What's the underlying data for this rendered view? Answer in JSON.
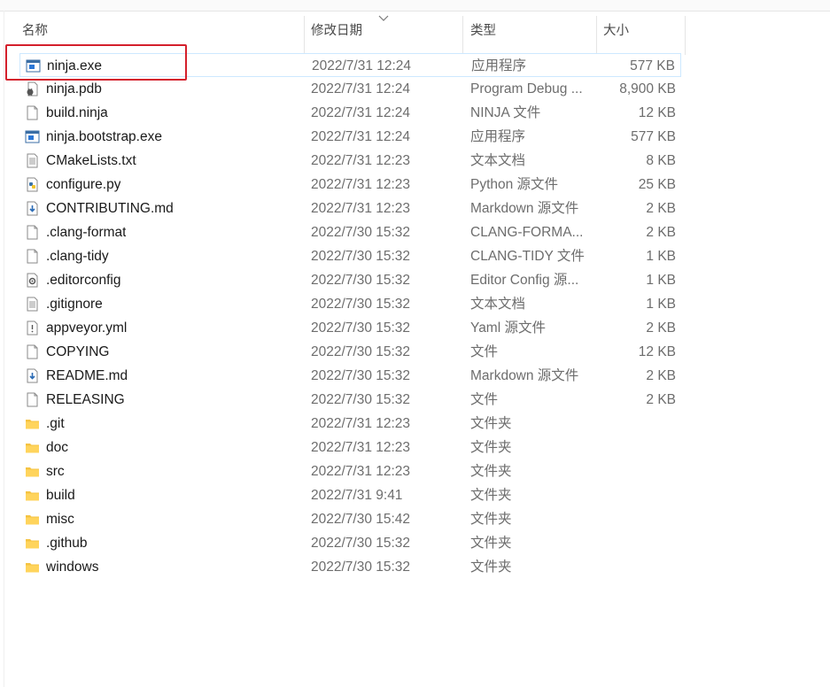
{
  "columns": {
    "name": "名称",
    "date": "修改日期",
    "type": "类型",
    "size": "大小"
  },
  "files": [
    {
      "name": "ninja.exe",
      "date": "2022/7/31 12:24",
      "type": "应用程序",
      "size": "577 KB",
      "icon": "exe-icon"
    },
    {
      "name": "ninja.pdb",
      "date": "2022/7/31 12:24",
      "type": "Program Debug ...",
      "size": "8,900 KB",
      "icon": "pdb-icon"
    },
    {
      "name": "build.ninja",
      "date": "2022/7/31 12:24",
      "type": "NINJA 文件",
      "size": "12 KB",
      "icon": "file-icon"
    },
    {
      "name": "ninja.bootstrap.exe",
      "date": "2022/7/31 12:24",
      "type": "应用程序",
      "size": "577 KB",
      "icon": "exe-icon"
    },
    {
      "name": "CMakeLists.txt",
      "date": "2022/7/31 12:23",
      "type": "文本文档",
      "size": "8 KB",
      "icon": "text-file-icon"
    },
    {
      "name": "configure.py",
      "date": "2022/7/31 12:23",
      "type": "Python 源文件",
      "size": "25 KB",
      "icon": "python-file-icon"
    },
    {
      "name": "CONTRIBUTING.md",
      "date": "2022/7/31 12:23",
      "type": "Markdown 源文件",
      "size": "2 KB",
      "icon": "markdown-file-icon"
    },
    {
      "name": ".clang-format",
      "date": "2022/7/30 15:32",
      "type": "CLANG-FORMA...",
      "size": "2 KB",
      "icon": "file-icon"
    },
    {
      "name": ".clang-tidy",
      "date": "2022/7/30 15:32",
      "type": "CLANG-TIDY 文件",
      "size": "1 KB",
      "icon": "file-icon"
    },
    {
      "name": ".editorconfig",
      "date": "2022/7/30 15:32",
      "type": "Editor Config 源...",
      "size": "1 KB",
      "icon": "config-file-icon"
    },
    {
      "name": ".gitignore",
      "date": "2022/7/30 15:32",
      "type": "文本文档",
      "size": "1 KB",
      "icon": "text-file-icon"
    },
    {
      "name": "appveyor.yml",
      "date": "2022/7/30 15:32",
      "type": "Yaml 源文件",
      "size": "2 KB",
      "icon": "yaml-file-icon"
    },
    {
      "name": "COPYING",
      "date": "2022/7/30 15:32",
      "type": "文件",
      "size": "12 KB",
      "icon": "file-icon"
    },
    {
      "name": "README.md",
      "date": "2022/7/30 15:32",
      "type": "Markdown 源文件",
      "size": "2 KB",
      "icon": "markdown-file-icon"
    },
    {
      "name": "RELEASING",
      "date": "2022/7/30 15:32",
      "type": "文件",
      "size": "2 KB",
      "icon": "file-icon"
    },
    {
      "name": ".git",
      "date": "2022/7/31 12:23",
      "type": "文件夹",
      "size": "",
      "icon": "folder-icon"
    },
    {
      "name": "doc",
      "date": "2022/7/31 12:23",
      "type": "文件夹",
      "size": "",
      "icon": "folder-icon"
    },
    {
      "name": "src",
      "date": "2022/7/31 12:23",
      "type": "文件夹",
      "size": "",
      "icon": "folder-icon"
    },
    {
      "name": "build",
      "date": "2022/7/31 9:41",
      "type": "文件夹",
      "size": "",
      "icon": "folder-icon"
    },
    {
      "name": "misc",
      "date": "2022/7/30 15:42",
      "type": "文件夹",
      "size": "",
      "icon": "folder-icon"
    },
    {
      "name": ".github",
      "date": "2022/7/30 15:32",
      "type": "文件夹",
      "size": "",
      "icon": "folder-icon"
    },
    {
      "name": "windows",
      "date": "2022/7/30 15:32",
      "type": "文件夹",
      "size": "",
      "icon": "folder-icon"
    }
  ],
  "colors": {
    "highlight_box": "#d4202c",
    "selection_border": "#cde8ff",
    "folder": "#f5c342"
  }
}
